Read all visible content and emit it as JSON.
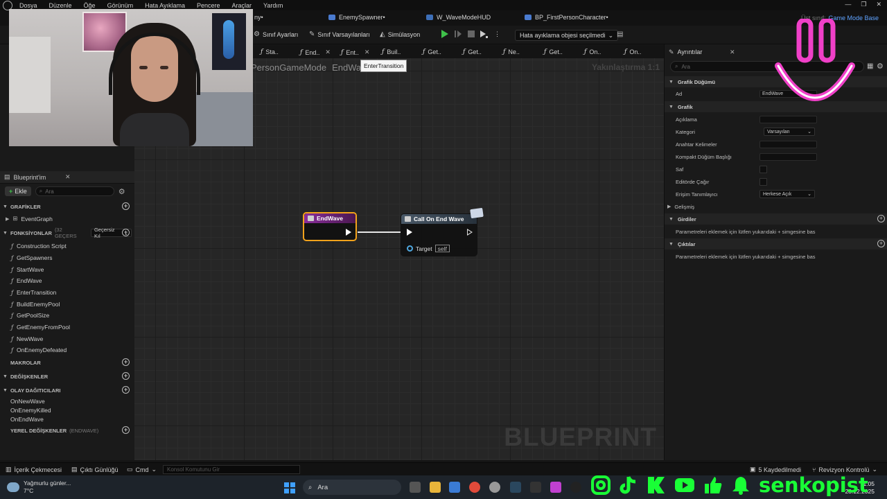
{
  "menu": [
    "Dosya",
    "Düzenle",
    "Öğe",
    "Görünüm",
    "Hata Ayıklama",
    "Pencere",
    "Araçlar",
    "Yardım"
  ],
  "asset_tabs": [
    {
      "label": "ny•"
    },
    {
      "label": "EnemySpawner•"
    },
    {
      "label": "W_WaveModeHUD"
    },
    {
      "label": "BP_FirstPersonCharacter•"
    }
  ],
  "parent_class": {
    "label": "Üst sınıf:",
    "value": "Game Mode Base"
  },
  "toolbar": {
    "class_settings": "Sınıf Ayarları",
    "class_defaults": "Sınıf Varsayılanları",
    "simulation": "Simülasyon",
    "debug_object": "Hata ayıklama objesi seçilmedi"
  },
  "graph_tabs": [
    "Sta..",
    "End..",
    "Ent..",
    "Buil..",
    "Get..",
    "Get..",
    "Ne..",
    "Get..",
    "On..",
    "On.."
  ],
  "tooltip": "EnterTransition",
  "my_blueprint": {
    "title": "Blueprint'im",
    "add_label": "Ekle",
    "search_placeholder": "Ara",
    "sections": {
      "graphs": "GRAFİKLER",
      "functions": "FONKSİYONLAR",
      "functions_count": "(32 GEÇERS",
      "override_label": "Geçersiz Kıl",
      "macros": "MAKROLAR",
      "variables": "DEĞİŞKENLER",
      "dispatchers": "OLAY DAĞITICILARI",
      "locals": "YEREL DEĞİŞKENLER",
      "locals_suffix": "(ENDWAVE)"
    },
    "event_graph": "EventGraph",
    "functions": [
      "Construction Script",
      "GetSpawners",
      "StartWave",
      "EndWave",
      "EnterTransition",
      "BuildEnemyPool",
      "GetPoolSize",
      "GetEnemyFromPool",
      "NewWave",
      "OnEnemyDefeated"
    ],
    "dispatchers": [
      "OnNewWave",
      "OnEnemyKilled",
      "OnEndWave"
    ]
  },
  "graph": {
    "breadcrumb_root": "PersonGameMode",
    "breadcrumb_current": "EndWa",
    "zoom": "Yakınlaştırma 1:1",
    "watermark": "BLUEPRINT",
    "nodes": {
      "entry_title": "EndWave",
      "call_title": "Call On End Wave",
      "target_label": "Target",
      "target_value": "self"
    }
  },
  "details": {
    "title": "Ayrıntılar",
    "search_placeholder": "Ara",
    "graph_node_group": "Grafik Düğümü",
    "name_label": "Ad",
    "name_value": "EndWave",
    "graph_group": "Grafik",
    "description_label": "Açıklama",
    "category_label": "Kategori",
    "category_value": "Varsayılan",
    "keywords_label": "Anahtar Kelimeler",
    "compact_title_label": "Kompakt Düğüm Başlığı",
    "pure_label": "Saf",
    "call_in_editor_label": "Editörde Çağır",
    "access_label": "Erişim Tanımlayıcı",
    "access_value": "Herkese Açık",
    "advanced_group": "Gelişmiş",
    "inputs_group": "Girdiler",
    "inputs_hint": "Parametreleri eklemek için lütfen yukarıdaki + simgesine bas",
    "outputs_group": "Çıktılar",
    "outputs_hint": "Parametreleri eklemek için lütfen yukarıdaki + simgesine bas"
  },
  "status_bar": {
    "content_drawer": "İçerik Çekmecesi",
    "output_log": "Çıktı Günlüğü",
    "cmd": "Cmd",
    "console_placeholder": "Konsol Komutunu Gir",
    "saved": "5 Kaydedilmedi",
    "revision": "Revizyon Kontrolü"
  },
  "taskbar": {
    "weather_title": "Yağmurlu günler...",
    "weather_temp": "7°C",
    "search": "Ara",
    "time": "11:05",
    "date": "28.12.2025"
  },
  "overlay": {
    "handle": "senkopist"
  }
}
